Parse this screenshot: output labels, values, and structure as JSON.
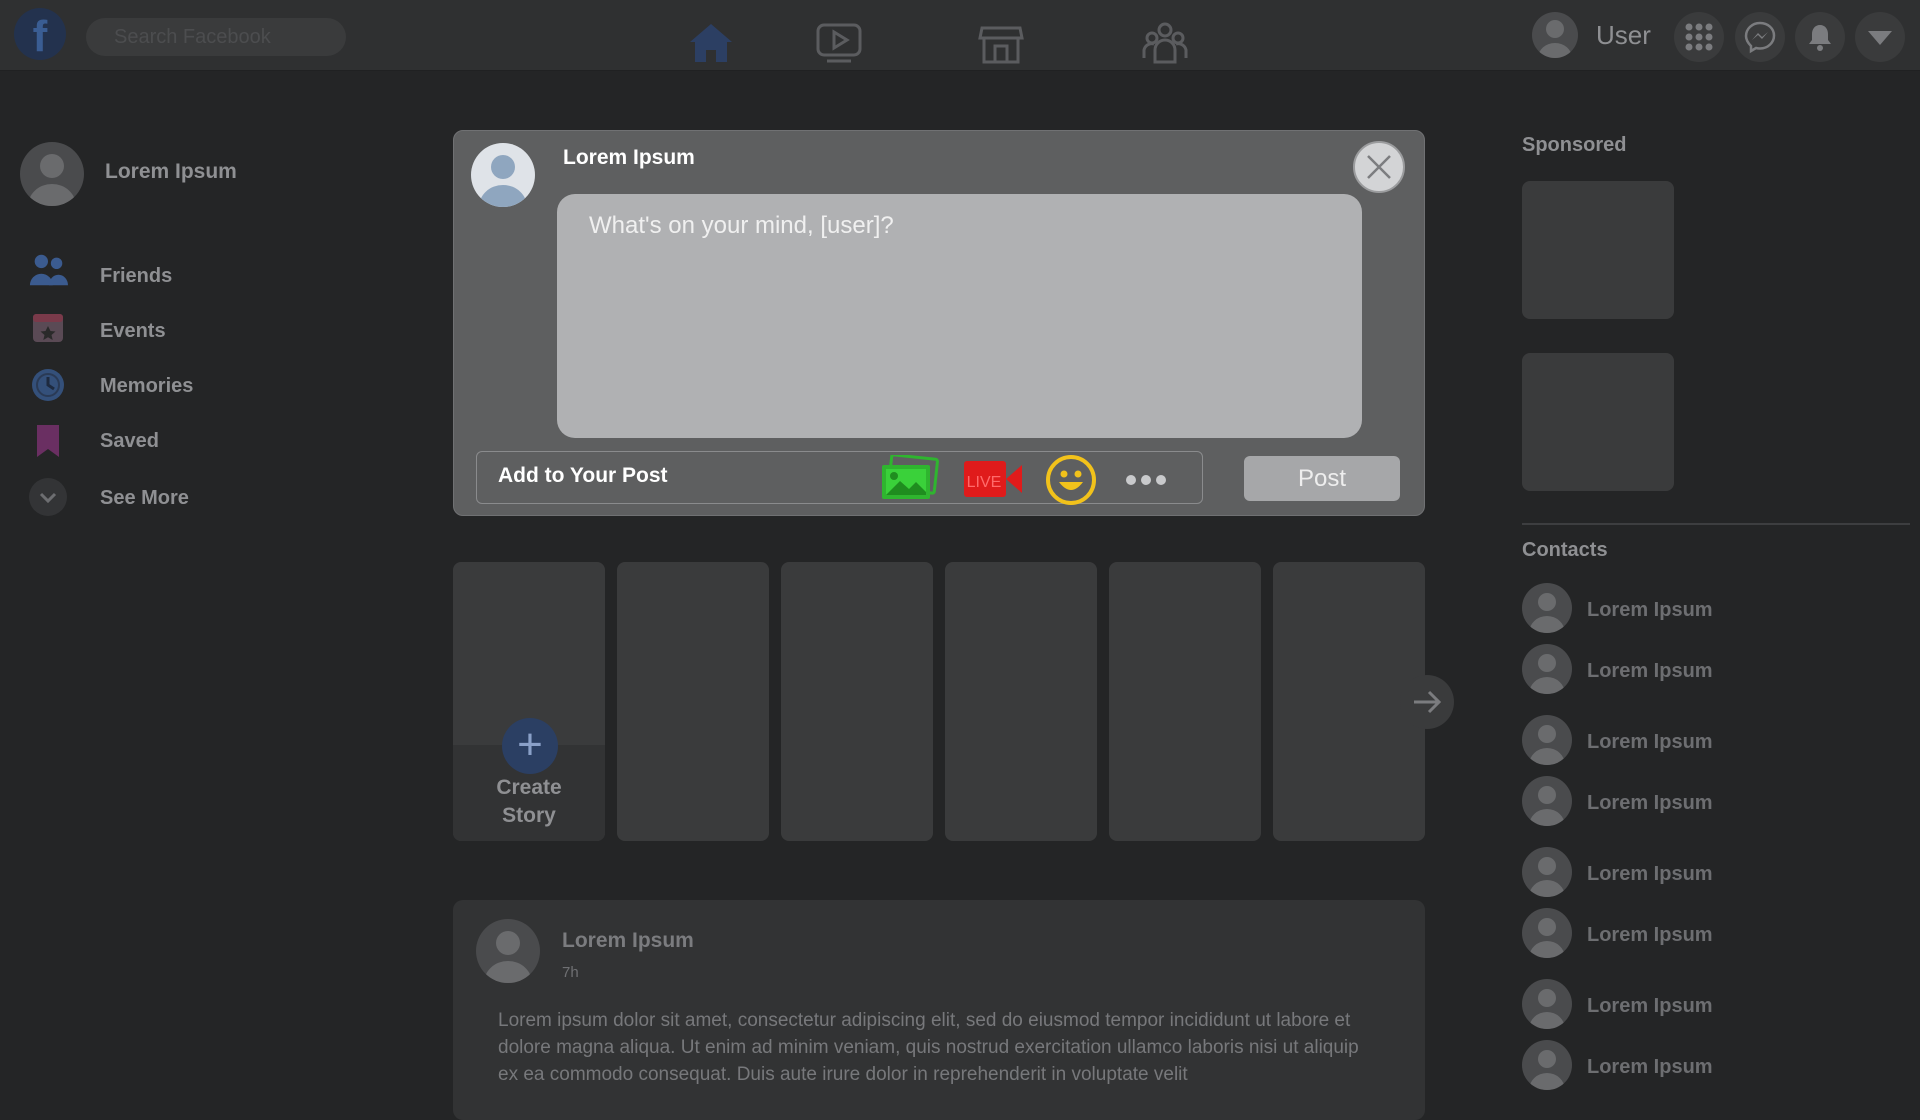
{
  "topbar": {
    "logo": "f",
    "search_placeholder": "Search Facebook",
    "user_name": "User",
    "nav_icons": [
      "home-icon",
      "watch-icon",
      "marketplace-icon",
      "groups-icon"
    ],
    "action_icons": [
      "menu-grid-icon",
      "messenger-icon",
      "notifications-bell-icon",
      "account-chevron-icon"
    ]
  },
  "sidebar": {
    "profile_name": "Lorem Ipsum",
    "items": [
      {
        "label": "Friends",
        "icon": "friends-icon"
      },
      {
        "label": "Events",
        "icon": "events-calendar-icon"
      },
      {
        "label": "Memories",
        "icon": "memories-clock-icon"
      },
      {
        "label": "Saved",
        "icon": "saved-bookmark-icon"
      },
      {
        "label": "See More",
        "icon": "chevron-down-icon"
      }
    ]
  },
  "composer": {
    "author": "Lorem Ipsum",
    "placeholder": "What's on your mind, [user]?",
    "add_label": "Add to Your Post",
    "live_label": "LIVE",
    "post_label": "Post",
    "colors": {
      "photo": "#2fb52f",
      "live": "#e01b1b",
      "feeling": "#f2c21b"
    }
  },
  "stories": {
    "create_label_1": "Create",
    "create_label_2": "Story",
    "count": 6
  },
  "feed_post": {
    "author": "Lorem Ipsum",
    "time": "7h",
    "text": "Lorem ipsum dolor sit amet, consectetur adipiscing elit, sed do eiusmod tempor incididunt ut labore et dolore magna aliqua. Ut enim ad minim veniam, quis nostrud exercitation ullamco laboris nisi ut aliquip ex ea commodo consequat. Duis aute irure dolor in reprehenderit in voluptate velit"
  },
  "right": {
    "sponsored_title": "Sponsored",
    "contacts_title": "Contacts",
    "contacts": [
      "Lorem Ipsum",
      "Lorem Ipsum",
      "Lorem Ipsum",
      "Lorem Ipsum",
      "Lorem Ipsum",
      "Lorem Ipsum",
      "Lorem Ipsum",
      "Lorem Ipsum"
    ]
  }
}
